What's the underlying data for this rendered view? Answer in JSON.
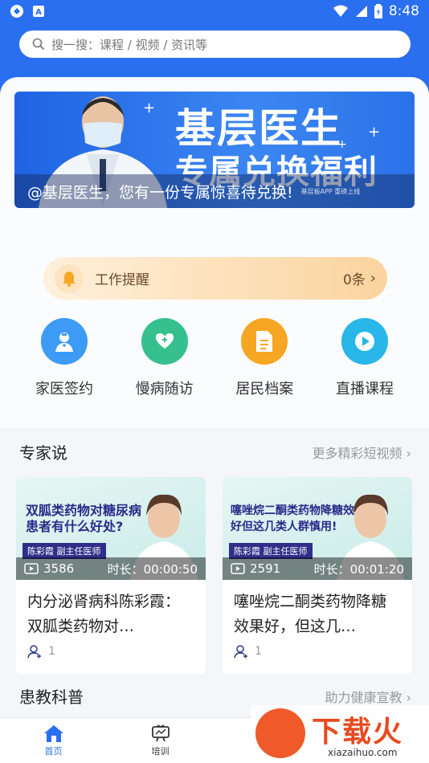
{
  "status_bar": {
    "time": "8:48"
  },
  "search": {
    "placeholder": "搜一搜：课程 / 视频 / 资讯等"
  },
  "banner": {
    "title_line1": "基层医生",
    "title_line2": "专属兑换福利",
    "caption": "@基层医生，您有一份专属惊喜待兑换!",
    "small_text": "基层板APP 重磅上线"
  },
  "reminder": {
    "label": "工作提醒",
    "count": "0条"
  },
  "quick_actions": [
    {
      "label": "家医签约",
      "icon": "doctor-icon",
      "color": "#3d9bf5"
    },
    {
      "label": "慢病随访",
      "icon": "heart-plus-icon",
      "color": "#37c08f"
    },
    {
      "label": "居民档案",
      "icon": "document-icon",
      "color": "#f6a623"
    },
    {
      "label": "直播课程",
      "icon": "play-icon",
      "color": "#29b6e8"
    }
  ],
  "expert": {
    "title": "专家说",
    "more": "更多精彩短视频",
    "videos": [
      {
        "thumb_title": "双胍类药物对糖尿病患者有什么好处?",
        "thumb_tag": "陈彩霞  副主任医师",
        "views": "3586",
        "duration": "时长：00:00:50",
        "title": "内分泌肾病科陈彩霞：双胍类药物对…",
        "likes": "1"
      },
      {
        "thumb_title": "噻唑烷二酮类药物降糖效果好但这几类人群慎用!",
        "thumb_tag": "陈彩霞  副主任医师",
        "views": "2591",
        "duration": "时长：00:01:20",
        "title": "噻唑烷二酮类药物降糖效果好，但这几…",
        "likes": "1"
      }
    ]
  },
  "education": {
    "title": "患教科普",
    "more": "助力健康宣教"
  },
  "tabbar": [
    {
      "label": "首页",
      "icon": "home-icon",
      "active": true
    },
    {
      "label": "培训",
      "icon": "training-icon",
      "active": false
    }
  ],
  "watermark": {
    "text": "下载火",
    "url": "xiazaihuo.com"
  },
  "colors": {
    "primary": "#2a6ff0",
    "reminder_text": "#6a4a2a"
  }
}
